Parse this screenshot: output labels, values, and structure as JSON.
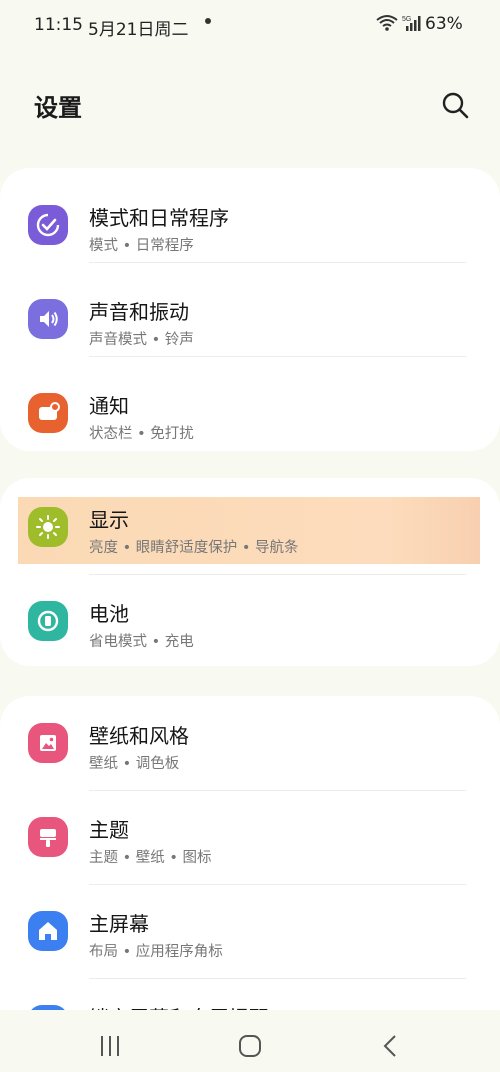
{
  "status_bar": {
    "time": "11:15",
    "date": "5月21日周二",
    "network": "5G",
    "battery": "63%"
  },
  "header": {
    "title": "设置",
    "search_icon": "search-icon"
  },
  "groups": [
    {
      "items": [
        {
          "title": "模式和日常程序",
          "subtitle": "模式 • 日常程序",
          "icon": "check-routine-icon",
          "color": "#7a5bd8"
        },
        {
          "title": "声音和振动",
          "subtitle": "声音模式 • 铃声",
          "icon": "speaker-icon",
          "color": "#7b6fe0"
        },
        {
          "title": "通知",
          "subtitle": "状态栏 • 免打扰",
          "icon": "notification-icon",
          "color": "#e8622f"
        }
      ]
    },
    {
      "items": [
        {
          "title": "显示",
          "subtitle": "亮度 • 眼睛舒适度保护 • 导航条",
          "icon": "brightness-icon",
          "color": "#9fbd2b"
        },
        {
          "title": "电池",
          "subtitle": "省电模式 • 充电",
          "icon": "battery-icon",
          "color": "#2fb6a0"
        }
      ]
    },
    {
      "items": [
        {
          "title": "壁纸和风格",
          "subtitle": "壁纸 • 调色板",
          "icon": "wallpaper-icon",
          "color": "#e8567e"
        },
        {
          "title": "主题",
          "subtitle": "主题 • 壁纸 • 图标",
          "icon": "theme-brush-icon",
          "color": "#e8567e"
        },
        {
          "title": "主屏幕",
          "subtitle": "布局 • 应用程序角标",
          "icon": "home-icon",
          "color": "#3b7ff0"
        },
        {
          "title": "锁定屏幕和息屏提醒",
          "subtitle": "",
          "icon": "lock-icon",
          "color": "#3b7ff0"
        }
      ]
    }
  ],
  "nav_bar": {
    "recents_icon": "recents-icon",
    "home_icon": "home-button-icon",
    "back_icon": "back-icon"
  }
}
